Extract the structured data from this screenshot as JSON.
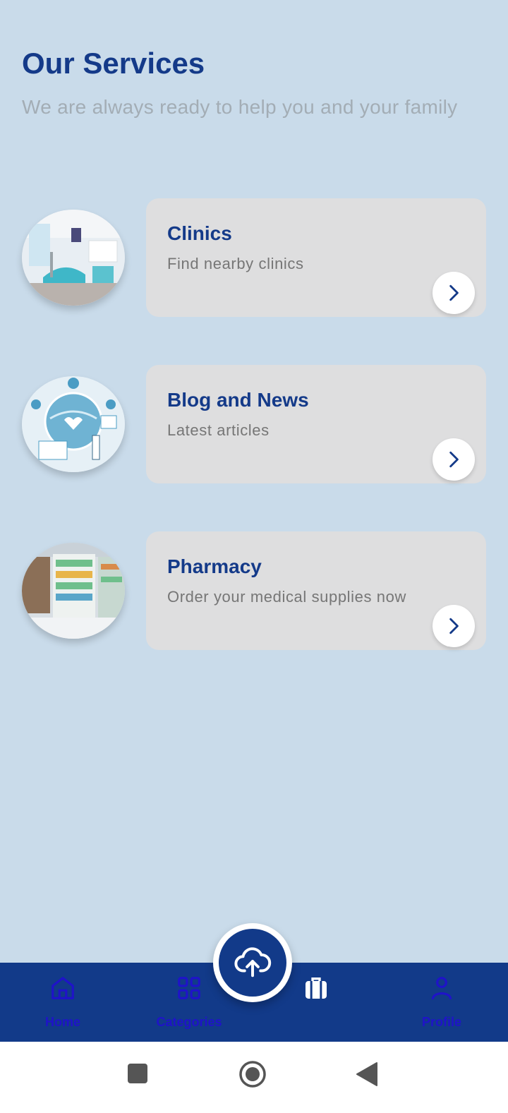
{
  "header": {
    "title": "Our Services",
    "subtitle": "We are always ready to help you and your family"
  },
  "services": [
    {
      "title": "Clinics",
      "subtitle": "Find nearby clinics",
      "image": "clinic-photo"
    },
    {
      "title": "Blog and News",
      "subtitle": "Latest articles",
      "image": "medical-globe-illustration"
    },
    {
      "title": "Pharmacy",
      "subtitle": "Order your medical supplies now",
      "image": "pharmacy-shelves-photo"
    }
  ],
  "bottom_nav": {
    "items": [
      {
        "label": "Home",
        "icon": "home-icon"
      },
      {
        "label": "Categories",
        "icon": "grid-icon"
      },
      {
        "label": "",
        "icon": "briefcase-icon"
      },
      {
        "label": "Profile",
        "icon": "person-icon"
      }
    ],
    "fab_icon": "cloud-upload-icon"
  },
  "colors": {
    "background": "#c9dbea",
    "primary": "#143a89",
    "card": "#dededf",
    "nav_label": "#1f13c9"
  }
}
